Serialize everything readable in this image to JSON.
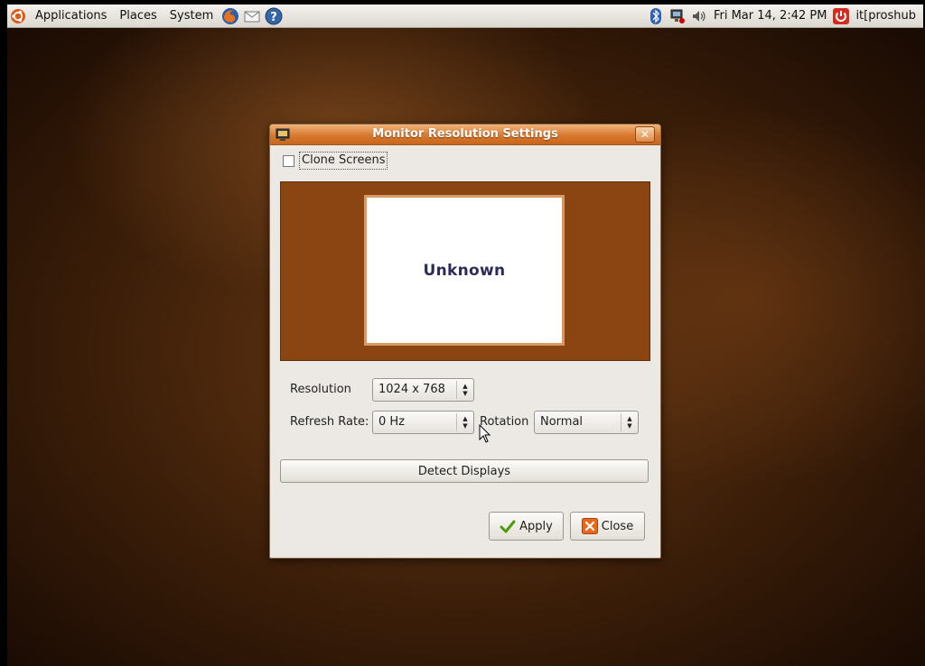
{
  "top_panel": {
    "menus": [
      "Applications",
      "Places",
      "System"
    ],
    "clock": "Fri Mar 14,  2:42 PM",
    "username": "it[proshub"
  },
  "dialog": {
    "title": "Monitor Resolution Settings",
    "clone_screens_label": "Clone Screens",
    "clone_screens_checked": false,
    "monitor_name": "Unknown",
    "resolution_label": "Resolution",
    "resolution_value": "1024 x 768",
    "refresh_rate_label": "Refresh Rate:",
    "refresh_rate_value": "0 Hz",
    "rotation_label": "Rotation",
    "rotation_value": "Normal",
    "detect_displays_label": "Detect Displays",
    "apply_label": "Apply",
    "close_label": "Close"
  },
  "colors": {
    "title_gradient": "#d8782e",
    "preview_bg": "#8a4513",
    "monitor_border": "#d89a62"
  }
}
